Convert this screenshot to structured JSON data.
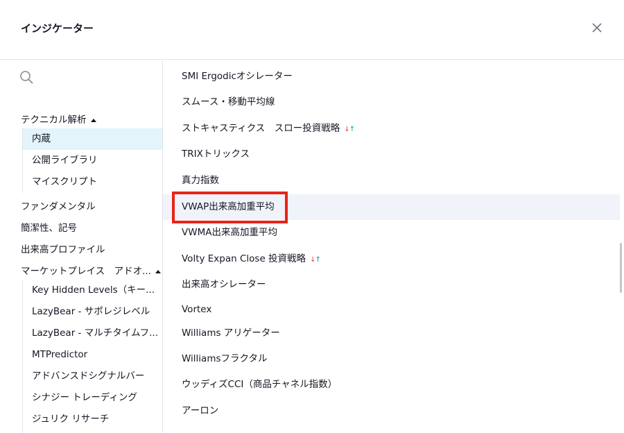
{
  "header": {
    "title": "インジケーター",
    "close_icon": "close-icon"
  },
  "search": {
    "placeholder": "",
    "value": ""
  },
  "left": {
    "technical": {
      "label": "テクニカル解析"
    },
    "technical_sub": [
      "内蔵",
      "公開ライブラリ",
      "マイスクリプト"
    ],
    "fundamental": "ファンダメンタル",
    "kanketsu": "簡潔性、記号",
    "volume_profile": "出来高プロファイル",
    "marketplace": {
      "label": "マーケットプレイス　アドオ..."
    },
    "marketplace_sub": [
      "Key Hidden Levels（キー...",
      "LazyBear - サポレジレベル",
      "LazyBear - マルチタイムフ...",
      "MTPredictor",
      "アドバンスドシグナルバー",
      "シナジー トレーディング",
      "ジュリク リサーチ"
    ]
  },
  "indicators": [
    {
      "label": "SMI Ergodicオシレーター"
    },
    {
      "label": "スムース・移動平均線"
    },
    {
      "label": "ストキャスティクス　スロー投資戦略",
      "arrows": true
    },
    {
      "label": "TRIXトリックス"
    },
    {
      "label": "真力指数"
    },
    {
      "label": "VWAP出来高加重平均"
    },
    {
      "label": "VWMA出来高加重平均"
    },
    {
      "label": "Volty Expan Close 投資戦略",
      "arrows": true
    },
    {
      "label": "出来高オシレーター"
    },
    {
      "label": "Vortex"
    },
    {
      "label": "Williams アリゲーター"
    },
    {
      "label": "Williamsフラクタル"
    },
    {
      "label": "ウッディズCCI（商品チャネル指数）"
    },
    {
      "label": "アーロン"
    }
  ],
  "arrows": {
    "down": "↓",
    "up": "↑"
  },
  "colors": {
    "highlight": "#e8231a",
    "active_bg": "#e3f4fb",
    "hover_bg": "#f0f3fa",
    "down": "#f23645",
    "up": "#089981"
  }
}
